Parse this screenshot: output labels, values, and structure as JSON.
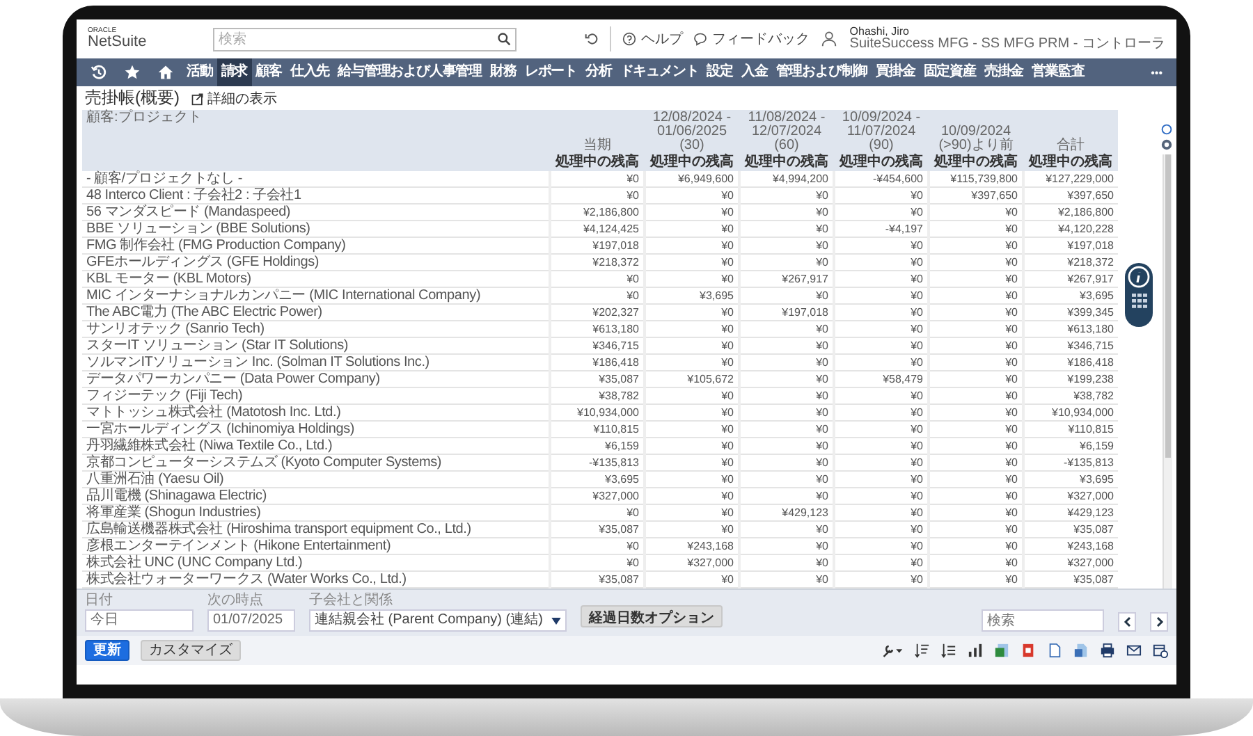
{
  "header": {
    "logo_top": "ORACLE",
    "logo": "NetSuite",
    "search": {
      "placeholder": "検索"
    },
    "help": "ヘルプ",
    "feedback": "フィードバック",
    "user": {
      "name": "Ohashi, Jiro",
      "role": "SuiteSuccess MFG - SS MFG PRM - コントローラ"
    }
  },
  "nav": {
    "items": [
      {
        "label": "活動",
        "selected": false
      },
      {
        "label": "請求",
        "selected": true
      },
      {
        "label": "顧客",
        "selected": false
      },
      {
        "label": "仕入先",
        "selected": false
      },
      {
        "label": "給与管理および人事管理",
        "selected": false
      },
      {
        "label": "財務",
        "selected": false
      },
      {
        "label": "レポート",
        "selected": false
      },
      {
        "label": "分析",
        "selected": false
      },
      {
        "label": "ドキュメント",
        "selected": false
      },
      {
        "label": "設定",
        "selected": false
      },
      {
        "label": "入金",
        "selected": false
      },
      {
        "label": "管理および制御",
        "selected": false
      },
      {
        "label": "買掛金",
        "selected": false
      },
      {
        "label": "固定資産",
        "selected": false
      },
      {
        "label": "売掛金",
        "selected": false
      },
      {
        "label": "営業監査",
        "selected": false
      }
    ],
    "more": "•••"
  },
  "page": {
    "title": "売掛帳(概要)",
    "detail_link": "詳細の表示"
  },
  "table": {
    "columns": [
      {
        "title": "顧客:プロジェクト"
      },
      {
        "title": "当期",
        "subtitle": "処理中の残高"
      },
      {
        "title": "12/08/2024 - 01/06/2025 (30)",
        "subtitle": "処理中の残高"
      },
      {
        "title": "11/08/2024 - 12/07/2024 (60)",
        "subtitle": "処理中の残高"
      },
      {
        "title": "10/09/2024 - 11/07/2024 (90)",
        "subtitle": "処理中の残高"
      },
      {
        "title": "10/09/2024 (>90)より前",
        "subtitle": "処理中の残高"
      },
      {
        "title": "合計",
        "subtitle": "処理中の残高"
      }
    ],
    "rows": [
      {
        "name": "- 顧客/プロジェクトなし -",
        "values": [
          "¥0",
          "¥6,949,600",
          "¥4,994,200",
          "-¥454,600",
          "¥115,739,800",
          "¥127,229,000"
        ]
      },
      {
        "name": "48 Interco Client : 子会社2 : 子会社1",
        "values": [
          "¥0",
          "¥0",
          "¥0",
          "¥0",
          "¥397,650",
          "¥397,650"
        ]
      },
      {
        "name": "56 マンダスピード (Mandaspeed)",
        "values": [
          "¥2,186,800",
          "¥0",
          "¥0",
          "¥0",
          "¥0",
          "¥2,186,800"
        ]
      },
      {
        "name": "BBE ソリューション (BBE Solutions)",
        "values": [
          "¥4,124,425",
          "¥0",
          "¥0",
          "-¥4,197",
          "¥0",
          "¥4,120,228"
        ]
      },
      {
        "name": "FMG 制作会社 (FMG Production Company)",
        "values": [
          "¥197,018",
          "¥0",
          "¥0",
          "¥0",
          "¥0",
          "¥197,018"
        ]
      },
      {
        "name": "GFEホールディングス (GFE Holdings)",
        "values": [
          "¥218,372",
          "¥0",
          "¥0",
          "¥0",
          "¥0",
          "¥218,372"
        ]
      },
      {
        "name": "KBL モーター (KBL Motors)",
        "values": [
          "¥0",
          "¥0",
          "¥267,917",
          "¥0",
          "¥0",
          "¥267,917"
        ]
      },
      {
        "name": "MIC インターナショナルカンパニー (MIC International Company)",
        "values": [
          "¥0",
          "¥3,695",
          "¥0",
          "¥0",
          "¥0",
          "¥3,695"
        ]
      },
      {
        "name": "The ABC電力 (The ABC Electric Power)",
        "values": [
          "¥202,327",
          "¥0",
          "¥197,018",
          "¥0",
          "¥0",
          "¥399,345"
        ]
      },
      {
        "name": "サンリオテック (Sanrio Tech)",
        "values": [
          "¥613,180",
          "¥0",
          "¥0",
          "¥0",
          "¥0",
          "¥613,180"
        ]
      },
      {
        "name": "スターIT ソリューション (Star IT Solutions)",
        "values": [
          "¥346,715",
          "¥0",
          "¥0",
          "¥0",
          "¥0",
          "¥346,715"
        ]
      },
      {
        "name": "ソルマンITソリューション Inc. (Solman IT Solutions Inc.)",
        "values": [
          "¥186,418",
          "¥0",
          "¥0",
          "¥0",
          "¥0",
          "¥186,418"
        ]
      },
      {
        "name": "データパワーカンパニー (Data Power Company)",
        "values": [
          "¥35,087",
          "¥105,672",
          "¥0",
          "¥58,479",
          "¥0",
          "¥199,238"
        ]
      },
      {
        "name": "フィジーテック (Fiji Tech)",
        "values": [
          "¥38,782",
          "¥0",
          "¥0",
          "¥0",
          "¥0",
          "¥38,782"
        ]
      },
      {
        "name": "マトトッシュ株式会社 (Matotosh Inc. Ltd.)",
        "values": [
          "¥10,934,000",
          "¥0",
          "¥0",
          "¥0",
          "¥0",
          "¥10,934,000"
        ]
      },
      {
        "name": "一宮ホールディングス (Ichinomiya Holdings)",
        "values": [
          "¥110,815",
          "¥0",
          "¥0",
          "¥0",
          "¥0",
          "¥110,815"
        ]
      },
      {
        "name": "丹羽繊維株式会社 (Niwa Textile Co., Ltd.)",
        "values": [
          "¥6,159",
          "¥0",
          "¥0",
          "¥0",
          "¥0",
          "¥6,159"
        ]
      },
      {
        "name": "京都コンピューターシステムズ (Kyoto Computer Systems)",
        "values": [
          "-¥135,813",
          "¥0",
          "¥0",
          "¥0",
          "¥0",
          "-¥135,813"
        ]
      },
      {
        "name": "八重洲石油 (Yaesu Oil)",
        "values": [
          "¥3,695",
          "¥0",
          "¥0",
          "¥0",
          "¥0",
          "¥3,695"
        ]
      },
      {
        "name": "品川電機 (Shinagawa Electric)",
        "values": [
          "¥327,000",
          "¥0",
          "¥0",
          "¥0",
          "¥0",
          "¥327,000"
        ]
      },
      {
        "name": "将軍産業 (Shogun Industries)",
        "values": [
          "¥0",
          "¥0",
          "¥429,123",
          "¥0",
          "¥0",
          "¥429,123"
        ]
      },
      {
        "name": "広島輸送機器株式会社 (Hiroshima transport equipment Co., Ltd.)",
        "values": [
          "¥35,087",
          "¥0",
          "¥0",
          "¥0",
          "¥0",
          "¥35,087"
        ]
      },
      {
        "name": "彦根エンターテインメント (Hikone Entertainment)",
        "values": [
          "¥0",
          "¥243,168",
          "¥0",
          "¥0",
          "¥0",
          "¥243,168"
        ]
      },
      {
        "name": "株式会社 UNC (UNC Company Ltd.)",
        "values": [
          "¥0",
          "¥327,000",
          "¥0",
          "¥0",
          "¥0",
          "¥327,000"
        ]
      },
      {
        "name": "株式会社ウォーターワークス (Water Works Co., Ltd.)",
        "values": [
          "¥35,087",
          "¥0",
          "¥0",
          "¥0",
          "¥0",
          "¥35,087"
        ]
      }
    ]
  },
  "filters": [
    {
      "kind": "input",
      "label": "日付",
      "value": "今日"
    },
    {
      "kind": "input",
      "label": "次の時点",
      "value": "01/07/2025"
    },
    {
      "kind": "select",
      "label": "子会社と関係",
      "value": "連結親会社 (Parent Company) (連結)"
    }
  ],
  "aging_button": "経過日数オプション",
  "search": {
    "placeholder": "検索"
  },
  "buttons": [
    {
      "label": "更新",
      "primary": true
    },
    {
      "label": "カスタマイズ",
      "primary": false
    }
  ]
}
